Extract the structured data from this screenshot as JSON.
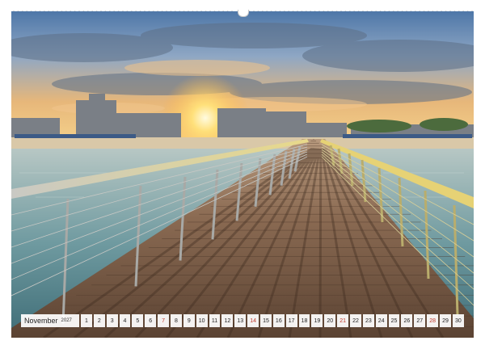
{
  "calendar": {
    "month": "November",
    "year": "2027",
    "days": [
      "1",
      "2",
      "3",
      "4",
      "5",
      "6",
      "7",
      "8",
      "9",
      "10",
      "11",
      "12",
      "13",
      "14",
      "15",
      "16",
      "17",
      "18",
      "19",
      "20",
      "21",
      "22",
      "23",
      "24",
      "25",
      "26",
      "27",
      "28",
      "29",
      "30"
    ],
    "sundays": [
      "7",
      "14",
      "21",
      "28"
    ],
    "sunday_color": "#c0392b"
  },
  "photo": {
    "subject": "Seebrücke bei Sonnenuntergang"
  }
}
